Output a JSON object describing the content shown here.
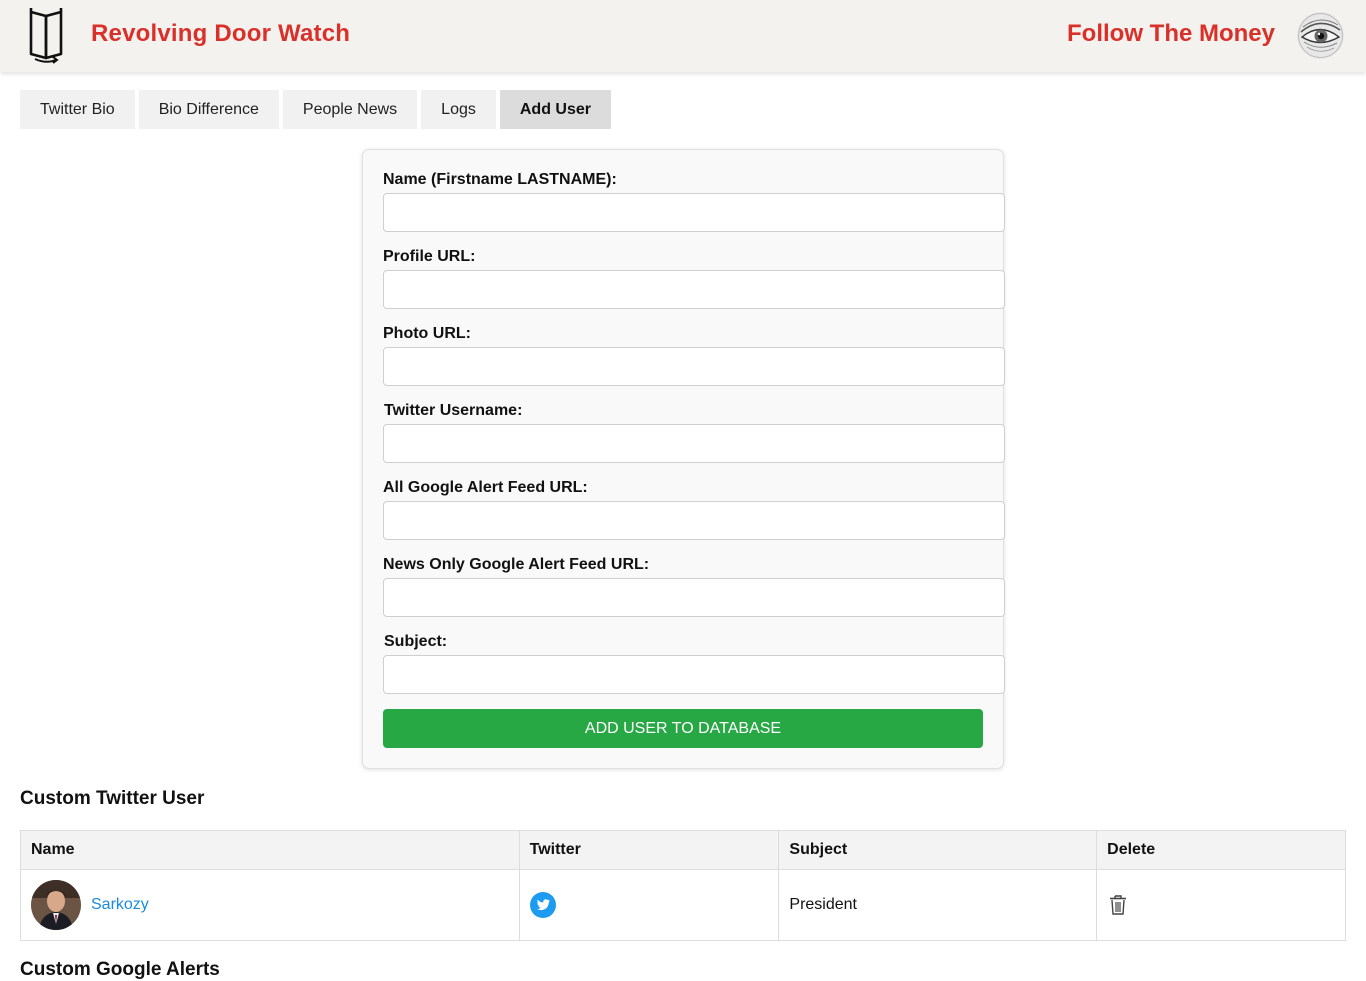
{
  "header": {
    "title": "Revolving Door Watch",
    "follow_link": "Follow The Money"
  },
  "tabs": [
    {
      "label": "Twitter Bio"
    },
    {
      "label": "Bio Difference"
    },
    {
      "label": "People News"
    },
    {
      "label": "Logs"
    },
    {
      "label": "Add User",
      "active": true
    }
  ],
  "form": {
    "fields": [
      {
        "label": "Name (Firstname LASTNAME):",
        "value": "",
        "placeholder": ""
      },
      {
        "label": "Profile URL:",
        "value": "",
        "placeholder": ""
      },
      {
        "label": "Photo URL:",
        "value": "",
        "placeholder": ""
      },
      {
        "label": "Twitter Username:",
        "value": "",
        "placeholder": ""
      },
      {
        "label": "All Google Alert Feed URL:",
        "value": "",
        "placeholder": ""
      },
      {
        "label": "News Only Google Alert Feed URL:",
        "value": "",
        "placeholder": ""
      },
      {
        "label": "Subject:",
        "value": "",
        "placeholder": ""
      }
    ],
    "submit_label": "ADD USER TO DATABASE"
  },
  "custom_twitter": {
    "title": "Custom Twitter User",
    "columns": [
      "Name",
      "Twitter",
      "Subject",
      "Delete"
    ],
    "rows": [
      {
        "name": "Sarkozy",
        "twitter_icon": "twitter-icon",
        "subject": "President",
        "delete_icon": "trash-icon"
      }
    ]
  },
  "custom_google_alerts": {
    "title": "Custom Google Alerts"
  },
  "colors": {
    "brand_red": "#d9302a",
    "submit_green": "#28a745",
    "link_blue": "#1a8be0",
    "twitter_blue": "#1d9bf0"
  }
}
